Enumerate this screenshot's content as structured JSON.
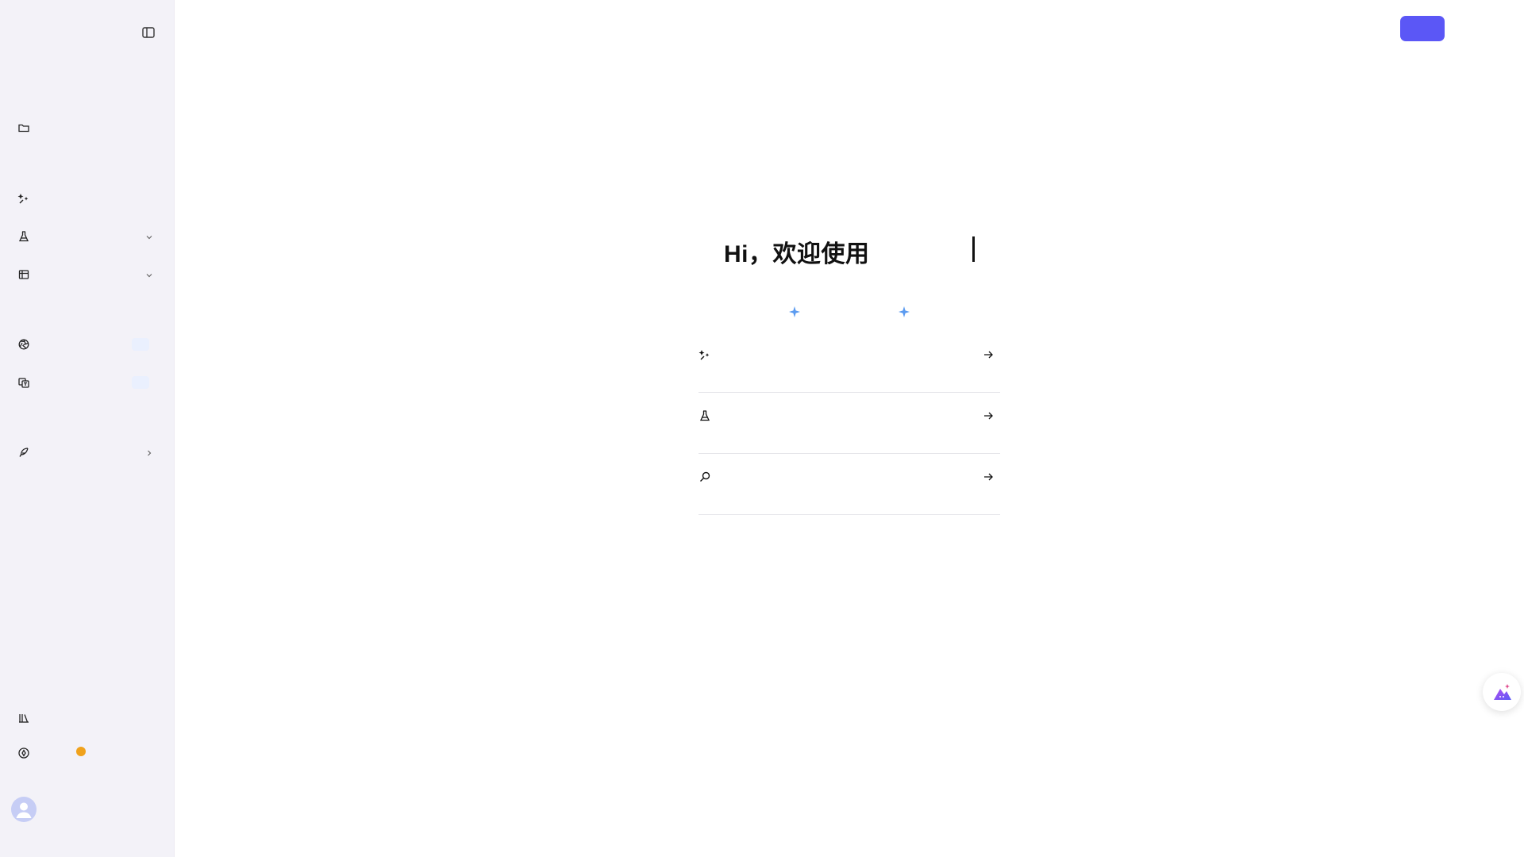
{
  "app": {
    "title": ""
  },
  "sidebar": {
    "collapse_icon": "sidebar-toggle-icon",
    "items": [
      {
        "id": "folder",
        "icon": "folder-icon",
        "label": "",
        "has_chevron": false
      },
      {
        "id": "sparkle-tool",
        "icon": "magic-sparkle-icon",
        "label": "",
        "has_chevron": false
      },
      {
        "id": "lab",
        "icon": "flask-icon",
        "label": "",
        "has_chevron": true,
        "chevron": "down"
      },
      {
        "id": "table",
        "icon": "table-icon",
        "label": "",
        "has_chevron": true,
        "chevron": "down"
      },
      {
        "id": "aperture",
        "icon": "aperture-icon",
        "label": "",
        "has_tag": true
      },
      {
        "id": "translate",
        "icon": "translate-icon",
        "label": "",
        "has_tag": true
      },
      {
        "id": "plugin",
        "icon": "feather-icon",
        "label": "",
        "has_chevron": true,
        "chevron": "right"
      }
    ],
    "bottom": [
      {
        "id": "library",
        "icon": "library-icon",
        "label": ""
      },
      {
        "id": "compass",
        "icon": "compass-icon",
        "label": "",
        "badge_color": "#f0a21c"
      }
    ],
    "avatar_icon": "user-avatar-icon"
  },
  "header": {
    "action_button_label": "",
    "action_button_color": "#5b57f6"
  },
  "main": {
    "greeting": "Hi，欢迎使用",
    "sparkle_color": "#5b9bf0",
    "actions": [
      {
        "icon": "magic-sparkle-icon",
        "label": ""
      },
      {
        "icon": "flask-icon",
        "label": ""
      },
      {
        "icon": "search-icon",
        "label": ""
      }
    ]
  },
  "floating": {
    "icon": "ai-assistant-icon"
  }
}
